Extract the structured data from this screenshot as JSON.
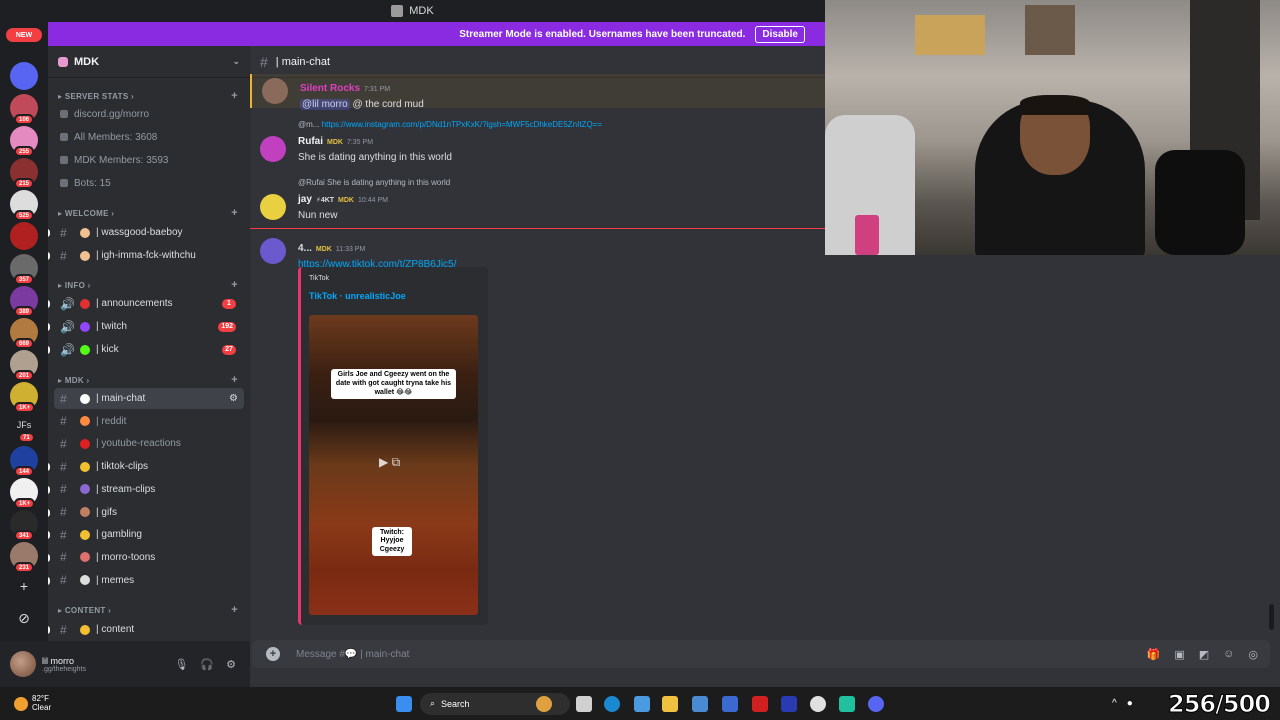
{
  "window": {
    "title": "MDK"
  },
  "banner": {
    "text": "Streamer Mode is enabled. Usernames have been truncated.",
    "button": "Disable"
  },
  "rail": {
    "new_label": "NEW",
    "servers": [
      {
        "badge": "",
        "color": "#5865f2"
      },
      {
        "badge": "106",
        "color": "#c04a5a"
      },
      {
        "badge": "255",
        "color": "#e48ac0"
      },
      {
        "badge": "215",
        "color": "#8a3030"
      },
      {
        "badge": "525",
        "color": "#dddddd"
      },
      {
        "badge": "",
        "color": "#b02020"
      },
      {
        "badge": "357",
        "color": "#6a6a6a"
      },
      {
        "badge": "389",
        "color": "#7a3aa0"
      },
      {
        "badge": "669",
        "color": "#b07a40"
      },
      {
        "badge": "201",
        "color": "#b0a090"
      },
      {
        "badge": "1K+",
        "color": "#d0b030"
      }
    ],
    "jf_text": "JFs",
    "jf_badge": "71",
    "more_servers": [
      {
        "badge": "144",
        "color": "#2040a0"
      },
      {
        "badge": "1K+",
        "color": "#f0f0f0"
      },
      {
        "badge": "341",
        "color": "#2a2a2a"
      },
      {
        "badge": "231",
        "color": "#9a7a6a"
      }
    ]
  },
  "sidebar": {
    "guild_name": "MDK",
    "stats_category": "SERVER STATS",
    "stats": [
      "discord.gg/morro",
      "All Members: 3608",
      "MDK Members: 3593",
      "Bots: 15"
    ],
    "welcome_category": "WELCOME",
    "welcome_channels": [
      {
        "name": "| wassgood-baeboy",
        "emoji_color": "#f0c090"
      },
      {
        "name": "| igh-imma-fck-withchu",
        "emoji_color": "#f0c090"
      }
    ],
    "info_category": "INFO",
    "info_channels": [
      {
        "name": "| announcements",
        "emoji_color": "#e03030",
        "count": "1"
      },
      {
        "name": "| twitch",
        "emoji_color": "#9146ff",
        "count": "192"
      },
      {
        "name": "| kick",
        "emoji_color": "#53fc18",
        "count": "27"
      }
    ],
    "mdk_category": "MDK",
    "mdk_channels": [
      {
        "name": "| main-chat",
        "emoji_color": "#ffffff"
      },
      {
        "name": "| reddit",
        "emoji_color": "#ff8a40"
      },
      {
        "name": "| youtube-reactions",
        "emoji_color": "#e02020"
      },
      {
        "name": "| tiktok-clips",
        "emoji_color": "#f0c030"
      },
      {
        "name": "| stream-clips",
        "emoji_color": "#8a6ad0"
      },
      {
        "name": "| gifs",
        "emoji_color": "#c08060"
      },
      {
        "name": "| gambling",
        "emoji_color": "#f0c030"
      },
      {
        "name": "| morro-toons",
        "emoji_color": "#e07070"
      },
      {
        "name": "| memes",
        "emoji_color": "#dddddd"
      }
    ],
    "content_category": "CONTENT",
    "content_channels": [
      {
        "name": "| content",
        "emoji_color": "#f0c030"
      }
    ]
  },
  "user": {
    "name": "lil morro",
    "status": ".gg/theheights"
  },
  "chat": {
    "channel": "| main-chat",
    "messages": [
      {
        "name": "Silent Rocks",
        "time": "7:31 PM",
        "mention": "@lil morro",
        "text": "@ the cord mud",
        "name_color": "#e040c0",
        "avatar_color": "#8a6a5a"
      },
      {
        "reply": "@m...",
        "reply_link": "https://www.instagram.com/p/DNd1nTPxKxK/?igsh=MWF5cDhkeDE5ZnItZQ==",
        "name": "Rufai",
        "tag": "MDK",
        "time": "7:35 PM",
        "text": "She is dating anything in this world",
        "name_color": "#f2f3f5",
        "avatar_color": "#c040c0"
      },
      {
        "reply": "@Rufai She is dating anything in this world",
        "name": "jay",
        "badge": "⚡4KT",
        "tag": "MDK",
        "time": "10:44 PM",
        "text": "Nun new",
        "name_color": "#f2f3f5",
        "avatar_color": "#e8d040"
      },
      {
        "name": "4...",
        "tag": "MDK",
        "time": "11:33 PM",
        "link": "https://www.tiktok.com/t/ZP8B6Jjc5/",
        "name_color": "#dbdee1",
        "avatar_color": "#6a5acd"
      }
    ],
    "embed": {
      "provider": "TikTok",
      "title": "TikTok · unrealisticJoe",
      "caption": "Girls Joe and Cgeezy went on the date with got caught tryna take his wallet 😂😂",
      "overlay": "Twitch: Hyyjoe Cgeezy"
    },
    "composer_placeholder": "Message #💬 | main-chat"
  },
  "taskbar": {
    "temp": "82°F",
    "weather": "Clear",
    "search": "Search",
    "overlay_counter": "256/500"
  }
}
